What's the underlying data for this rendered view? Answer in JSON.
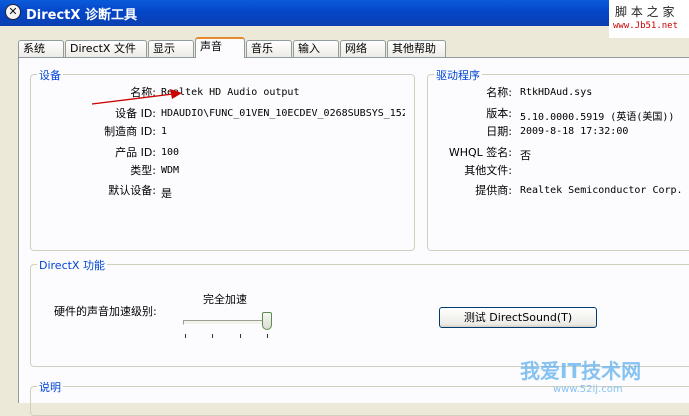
{
  "window": {
    "title": "DirectX 诊断工具",
    "icon": "directx-x-icon"
  },
  "watermark": {
    "brand": "脚 本 之 家",
    "url": "www.Jb51.net",
    "logo_text": "我爱IT技术网",
    "logo_url": "www.52ij.com"
  },
  "tabs": [
    {
      "label": "系统",
      "active": false
    },
    {
      "label": "DirectX 文件",
      "active": false
    },
    {
      "label": "显示",
      "active": false
    },
    {
      "label": "声音",
      "active": true
    },
    {
      "label": "音乐",
      "active": false
    },
    {
      "label": "输入",
      "active": false
    },
    {
      "label": "网络",
      "active": false
    },
    {
      "label": "其他帮助",
      "active": false
    }
  ],
  "device": {
    "title": "设备",
    "rows": [
      {
        "label": "名称:",
        "value": "Realtek HD Audio output"
      },
      {
        "label": "设备 ID:",
        "value": "HDAUDIO\\FUNC_01VEN_10ECDEV_0268SUBSYS_152"
      },
      {
        "label": "制造商 ID:",
        "value": "1"
      },
      {
        "label": "产品 ID:",
        "value": "100"
      },
      {
        "label": "类型:",
        "value": "WDM"
      },
      {
        "label": "默认设备:",
        "value": "是"
      }
    ]
  },
  "driver": {
    "title": "驱动程序",
    "rows": [
      {
        "label": "名称:",
        "value": "RtkHDAud.sys"
      },
      {
        "label": "版本:",
        "value": "5.10.0000.5919 (英语(美国))"
      },
      {
        "label": "日期:",
        "value": "2009-8-18 17:32:00"
      },
      {
        "label": "WHQL 签名:",
        "value": "否"
      },
      {
        "label": "其他文件:",
        "value": ""
      },
      {
        "label": "提供商:",
        "value": "Realtek Semiconductor Corp."
      }
    ]
  },
  "directx_features": {
    "title": "DirectX 功能",
    "accel_label": "硬件的声音加速级别:",
    "accel_value_label": "完全加速",
    "accel_level": 1.0,
    "accel_steps": 4,
    "test_button": "测试 DirectSound(T)"
  },
  "notes": {
    "title": "说明"
  },
  "colors": {
    "accent": "#0046d5",
    "title_bar": "#0a5bdb",
    "active_tab": "#e68b2c",
    "annotation_arrow": "#cc0000"
  }
}
